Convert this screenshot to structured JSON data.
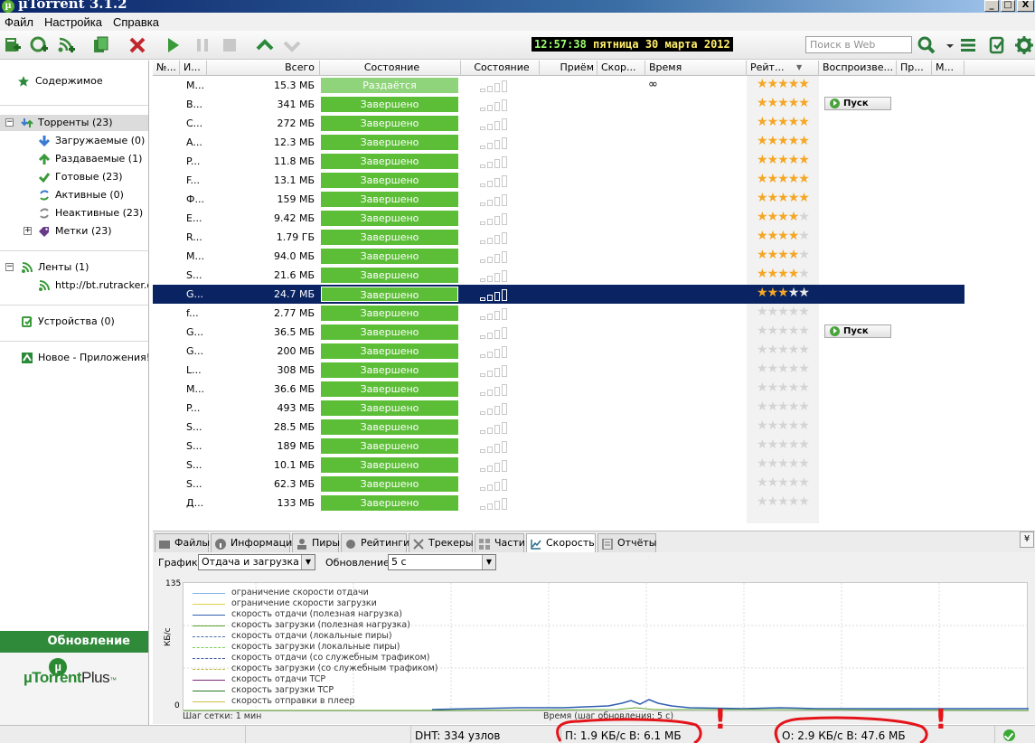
{
  "window": {
    "title": "µTorrent 3.1.2",
    "logo_glyph": "µ",
    "min_glyph": "_",
    "max_glyph": "□",
    "close_glyph": "X"
  },
  "menu": [
    "Файл",
    "Настройка",
    "Справка"
  ],
  "toolbar": {
    "clock_time": "12:57:38",
    "clock_date": "пятница 30 марта 2012",
    "search_placeholder": "Поиск в Web"
  },
  "sidebar": {
    "content": "Содержимое",
    "torrents": "Торренты (23)",
    "downloading": "Загружаемые (0)",
    "seeding": "Раздаваемые (1)",
    "completed": "Готовые (23)",
    "active": "Активные (0)",
    "inactive": "Неактивные (23)",
    "labels": "Метки (23)",
    "feeds": "Ленты (1)",
    "feed_url": "http://bt.rutracker.or",
    "devices": "Устройства (0)",
    "apps": "Новое - Приложения!",
    "expand_glyph": "+",
    "collapse_glyph": "−",
    "update_title": "Обновление",
    "plus_logo_a": "µTorrent",
    "plus_logo_b": "Plus",
    "plus_logo_tm": "™"
  },
  "columns": [
    "№...",
    "И...",
    "Всего",
    "Состояние",
    "Состояние",
    "Приём",
    "Скор...",
    "Время",
    "Рейт...",
    "Воспроизве...",
    "Пр...",
    "М..."
  ],
  "sort_glyph": "▼",
  "torrents": [
    {
      "name": "M...",
      "size": "15.3 МБ",
      "state": "Раздаётся",
      "eta": "∞",
      "stars": 5,
      "play": ""
    },
    {
      "name": "B...",
      "size": "341 МБ",
      "state": "Завершено",
      "eta": "",
      "stars": 5,
      "play": "Пуск"
    },
    {
      "name": "C...",
      "size": "272 МБ",
      "state": "Завершено",
      "eta": "",
      "stars": 5,
      "play": ""
    },
    {
      "name": "A...",
      "size": "12.3 МБ",
      "state": "Завершено",
      "eta": "",
      "stars": 5,
      "play": ""
    },
    {
      "name": "P...",
      "size": "11.8 МБ",
      "state": "Завершено",
      "eta": "",
      "stars": 5,
      "play": ""
    },
    {
      "name": "F...",
      "size": "13.1 МБ",
      "state": "Завершено",
      "eta": "",
      "stars": 5,
      "play": ""
    },
    {
      "name": "Ф...",
      "size": "159 МБ",
      "state": "Завершено",
      "eta": "",
      "stars": 5,
      "play": ""
    },
    {
      "name": "E...",
      "size": "9.42 МБ",
      "state": "Завершено",
      "eta": "",
      "stars": 4,
      "play": ""
    },
    {
      "name": "R...",
      "size": "1.79 ГБ",
      "state": "Завершено",
      "eta": "",
      "stars": 4,
      "play": ""
    },
    {
      "name": "M...",
      "size": "94.0 МБ",
      "state": "Завершено",
      "eta": "",
      "stars": 4,
      "play": ""
    },
    {
      "name": "S...",
      "size": "21.6 МБ",
      "state": "Завершено",
      "eta": "",
      "stars": 4,
      "play": ""
    },
    {
      "name": "G...",
      "size": "24.7 МБ",
      "state": "Завершено",
      "eta": "",
      "stars": 3,
      "play": ""
    },
    {
      "name": "f...",
      "size": "2.77 МБ",
      "state": "Завершено",
      "eta": "",
      "stars": 0,
      "play": ""
    },
    {
      "name": "G...",
      "size": "36.5 МБ",
      "state": "Завершено",
      "eta": "",
      "stars": 0,
      "play": "Пуск"
    },
    {
      "name": "G...",
      "size": "200 МБ",
      "state": "Завершено",
      "eta": "",
      "stars": 0,
      "play": ""
    },
    {
      "name": "L...",
      "size": "308 МБ",
      "state": "Завершено",
      "eta": "",
      "stars": 0,
      "play": ""
    },
    {
      "name": "M...",
      "size": "36.6 МБ",
      "state": "Завершено",
      "eta": "",
      "stars": 0,
      "play": ""
    },
    {
      "name": "P...",
      "size": "493 МБ",
      "state": "Завершено",
      "eta": "",
      "stars": 0,
      "play": ""
    },
    {
      "name": "S...",
      "size": "28.5 МБ",
      "state": "Завершено",
      "eta": "",
      "stars": 0,
      "play": ""
    },
    {
      "name": "S...",
      "size": "189 МБ",
      "state": "Завершено",
      "eta": "",
      "stars": 0,
      "play": ""
    },
    {
      "name": "S...",
      "size": "10.1 МБ",
      "state": "Завершено",
      "eta": "",
      "stars": 0,
      "play": ""
    },
    {
      "name": "S...",
      "size": "62.3 МБ",
      "state": "Завершено",
      "eta": "",
      "stars": 0,
      "play": ""
    },
    {
      "name": "Д...",
      "size": "133 МБ",
      "state": "Завершено",
      "eta": "",
      "stars": 0,
      "play": ""
    }
  ],
  "selected_row": 11,
  "tabs": [
    "Файлы",
    "Информация",
    "Пиры",
    "Рейтинги",
    "Трекеры",
    "Части",
    "Скорость",
    "Отчёты"
  ],
  "active_tab": "Скорость",
  "collapse_glyph": "¥",
  "speed": {
    "graph_label": "График:",
    "graph_value": "Отдача и загрузка",
    "update_label": "Обновление:",
    "update_value": "5 с",
    "combo_arrow": "▼",
    "y_unit": "КБ/с",
    "y_max": "135",
    "y_min": "0",
    "grid_step": "Шаг сетки: 1 мин",
    "x_axis": "Время (шаг обновления: 5 с)",
    "legend": [
      "ограничение скорости отдачи",
      "ограничение скорости загрузки",
      "скорость отдачи (полезная нагрузка)",
      "скорость загрузки (полезная нагрузка)",
      "скорость отдачи (локальные пиры)",
      "скорость загрузки (локальные пиры)",
      "скорость отдачи (со служебным трафиком)",
      "скорость загрузки (со служебным трафиком)",
      "скорость отдачи TCP",
      "скорость загрузки TCP",
      "скорость отправки в плеер"
    ],
    "legend_colors": [
      "#7fb3e8",
      "#e3d24a",
      "#2f5fb0",
      "#5aa02a",
      "#4a6fa8",
      "#7ccf4c",
      "#405ea0",
      "#b8b32c",
      "#7a2a7a",
      "#2a7a2a",
      "#d0c040"
    ]
  },
  "status": {
    "dht": "DHT: 334 узлов",
    "download": "П: 1.9 КБ/с В: 6.1 МБ",
    "upload": "О: 2.9 КБ/с В: 47.6 МБ"
  },
  "annotation_mark": "!"
}
